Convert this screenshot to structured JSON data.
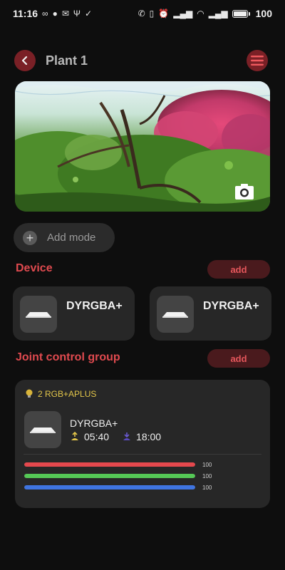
{
  "status_bar": {
    "time": "11:16",
    "battery": "100"
  },
  "header": {
    "title": "Plant 1"
  },
  "add_mode": {
    "label": "Add mode"
  },
  "device_section": {
    "title": "Device",
    "add_label": "add",
    "devices": [
      {
        "name": "DYRGBA+"
      },
      {
        "name": "DYRGBA+"
      }
    ]
  },
  "group_section": {
    "title": "Joint control group",
    "add_label": "add",
    "group": {
      "label": "2 RGB+APLUS",
      "device_name": "DYRGBA+",
      "sunrise": "05:40",
      "sunset": "18:00",
      "channels": [
        {
          "color": "#e5484d",
          "value": 100,
          "label": "100"
        },
        {
          "color": "#55c856",
          "value": 100,
          "label": "100"
        },
        {
          "color": "#3f74e0",
          "value": 100,
          "label": "100"
        }
      ]
    }
  },
  "colors": {
    "accent": "#e04a4f",
    "accent_dark": "#7a2026",
    "group_label": "#e3c64a"
  }
}
